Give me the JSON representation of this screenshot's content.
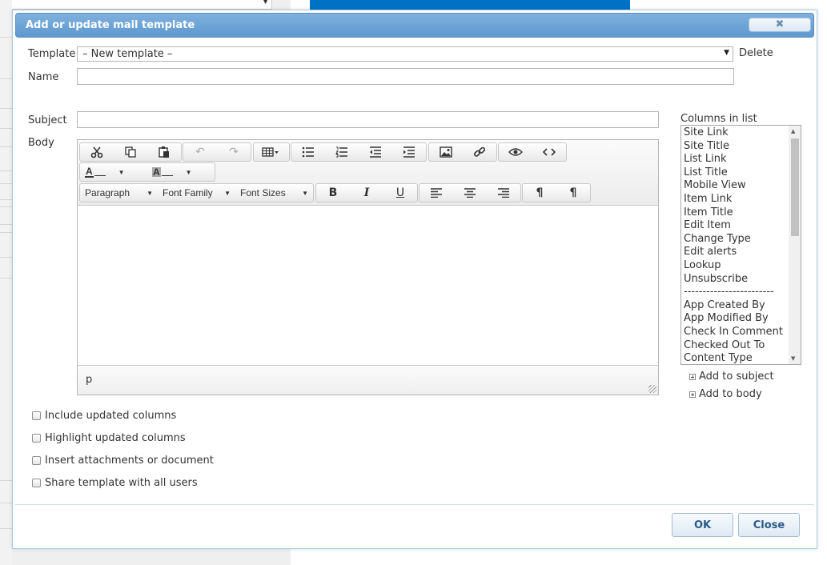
{
  "dialog": {
    "title": "Add or update mail template",
    "close_glyph": "✖"
  },
  "form": {
    "template_label": "Template",
    "template_value": "– New template –",
    "delete_label": "Delete",
    "name_label": "Name",
    "name_value": "",
    "subject_label": "Subject",
    "subject_value": "",
    "body_label": "Body"
  },
  "editor": {
    "format_dropdowns": [
      "Paragraph",
      "Font Family",
      "Font Sizes"
    ],
    "text_color_label": "A",
    "bg_color_label": "A",
    "status_path": "p",
    "icons": [
      "cut-icon",
      "copy-icon",
      "paste-icon",
      "undo-icon",
      "redo-icon",
      "table-icon",
      "bullet-list-icon",
      "numbered-list-icon",
      "outdent-icon",
      "indent-icon",
      "image-icon",
      "link-icon",
      "preview-icon",
      "code-icon",
      "bold-icon",
      "italic-icon",
      "underline-icon",
      "align-left-icon",
      "align-center-icon",
      "align-right-icon",
      "ltr-icon",
      "rtl-icon"
    ]
  },
  "columns": {
    "label": "Columns in list",
    "items": [
      "Site Link",
      "Site Title",
      "List Link",
      "List Title",
      "Mobile View",
      "Item Link",
      "Item Title",
      "Edit Item",
      "Change Type",
      "Edit alerts",
      "Lookup",
      "Unsubscribe",
      "------------------------",
      "App Created By",
      "App Modified By",
      "Check In Comment",
      "Checked Out To",
      "Content Type"
    ],
    "add_to_subject": "Add to subject",
    "add_to_body": "Add to body"
  },
  "options": [
    {
      "label": "Include updated columns",
      "checked": false
    },
    {
      "label": "Highlight updated columns",
      "checked": false
    },
    {
      "label": "Insert attachments or document",
      "checked": false
    },
    {
      "label": "Share template with all users",
      "checked": false
    }
  ],
  "buttons": {
    "ok": "OK",
    "close": "Close"
  },
  "colors": {
    "title_bar": "#6aa3d6",
    "bg_accent": "#0072c6"
  }
}
